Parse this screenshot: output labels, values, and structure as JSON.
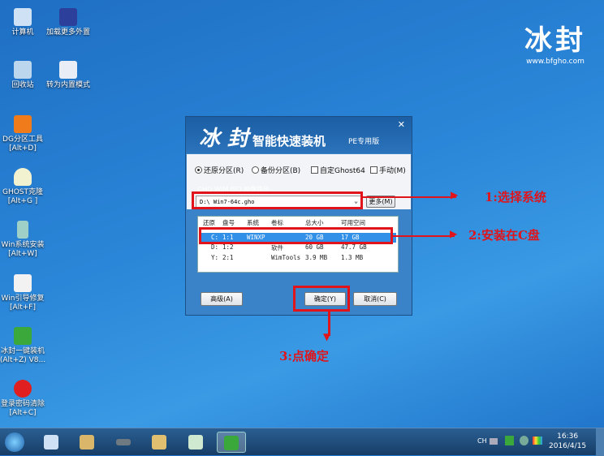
{
  "desktop": {
    "icons": [
      {
        "label": "计算机",
        "sub": ""
      },
      {
        "label": "加载更多外置",
        "sub": ""
      },
      {
        "label": "回收站",
        "sub": ""
      },
      {
        "label": "转为内置模式",
        "sub": ""
      },
      {
        "label": "DG分区工具",
        "sub": "[Alt+D]"
      },
      {
        "label": "GHOST克隆",
        "sub": "[Alt+G ]"
      },
      {
        "label": "Win系统安装",
        "sub": "[Alt+W]"
      },
      {
        "label": "Win引导修复",
        "sub": "[Alt+F]"
      },
      {
        "label": "冰封一键装机",
        "sub": "(Alt+Z) V8..."
      },
      {
        "label": "登录密码清除",
        "sub": "[Alt+C]"
      }
    ]
  },
  "logo": {
    "title": "冰封",
    "url": "www.bfgho.com"
  },
  "dialog": {
    "brand": "冰 封",
    "title": "智能快速装机",
    "edition": "PE专用版",
    "close": "✕",
    "options": [
      "还原分区(R)",
      "备份分区(B)",
      "自定Ghost64",
      "手动(M)"
    ],
    "path_label": "GHO WIM ISO 映像路径",
    "path_value": "D:\\ Win7-64c.gho",
    "more_button": "更多(M)",
    "columns": [
      "还原",
      "盘号",
      "系统",
      "卷标",
      "总大小",
      "可用空间"
    ],
    "rows": [
      {
        "drive": "C:",
        "disk": "1:1",
        "system": "WINXP",
        "label": "",
        "total": "20 GB",
        "free": "17 GB"
      },
      {
        "drive": "D:",
        "disk": "1:2",
        "system": "",
        "label": "软件",
        "total": "60 GB",
        "free": "47.7 GB"
      },
      {
        "drive": "Y:",
        "disk": "2:1",
        "system": "",
        "label": "WimTools",
        "total": "3.9 MB",
        "free": "1.3 MB"
      }
    ],
    "advanced_button": "高级(A)",
    "ok_button": "确定(Y)",
    "cancel_button": "取消(C)"
  },
  "annotations": {
    "step1": "1:选择系统",
    "step2": "2:安装在C盘",
    "step3": "3:点确定"
  },
  "taskbar": {
    "lang": "CH",
    "time": "16:36",
    "date": "2016/4/15"
  }
}
